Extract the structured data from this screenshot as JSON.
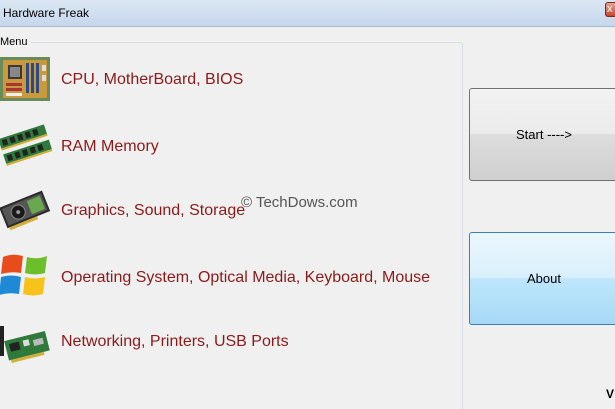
{
  "window": {
    "title": "Hardware Freak",
    "close_glyph": "x"
  },
  "menu": {
    "legend": "Menu",
    "items": [
      {
        "label": "CPU, MotherBoard, BIOS",
        "icon": "motherboard-icon"
      },
      {
        "label": "RAM Memory",
        "icon": "ram-icon"
      },
      {
        "label": "Graphics, Sound, Storage",
        "icon": "graphics-card-icon"
      },
      {
        "label": "Operating System, Optical Media, Keyboard, Mouse",
        "icon": "windows-logo-icon"
      },
      {
        "label": "Networking, Printers, USB Ports",
        "icon": "network-card-icon"
      }
    ]
  },
  "buttons": {
    "start": "Start ---->",
    "about": "About"
  },
  "watermark": "© TechDows.com",
  "version": "V",
  "colors": {
    "menu_text": "#8b1a1a",
    "about_button": "#bee6fd",
    "titlebar": "#c6d7ec"
  }
}
